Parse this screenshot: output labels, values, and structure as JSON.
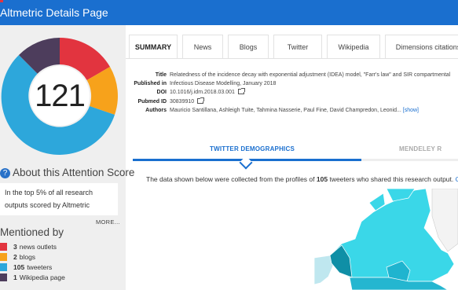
{
  "header": {
    "title": "Altmetric Details Page",
    "bg_color": "#1a6fcf"
  },
  "sidebar": {
    "score": "121",
    "about_title": "About this Attention Score",
    "rank_text": [
      "In the top 5% of all research",
      "outputs scored by Altmetric"
    ],
    "more_label": "MORE...",
    "mentioned_title": "Mentioned by",
    "mentions": [
      {
        "count": "3",
        "label": "news outlets",
        "color": "#e2343f"
      },
      {
        "count": "2",
        "label": "blogs",
        "color": "#f7a21b"
      },
      {
        "count": "105",
        "label": "tweeters",
        "color": "#2da7db"
      },
      {
        "count": "1",
        "label": "Wikipedia page",
        "color": "#4d3d5c"
      }
    ]
  },
  "tabs": [
    {
      "label": "SUMMARY",
      "active": true
    },
    {
      "label": "News"
    },
    {
      "label": "Blogs"
    },
    {
      "label": "Twitter"
    },
    {
      "label": "Wikipedia"
    },
    {
      "label": "Dimensions citations"
    }
  ],
  "details": {
    "title_label": "Title",
    "title_value": "Relatedness of the incidence decay with exponential adjustment (IDEA) model, \"Farr's law\" and SIR compartmental",
    "published_label": "Published in",
    "published_value": "Infectious Disease Modelling, January 2018",
    "doi_label": "DOI",
    "doi_value": "10.1016/j.idm.2018.03.001",
    "pubmed_label": "Pubmed ID",
    "pubmed_value": "30839910",
    "authors_label": "Authors",
    "authors_value": "Mauricio Santillana, Ashleigh Tuite, Tahmina Nasserie, Paul Fine, David Champredon, Leonid...",
    "show_label": "[show]"
  },
  "demographics": {
    "twitter_tab": "TWITTER DEMOGRAPHICS",
    "mendeley_tab": "MENDELEY R",
    "description_prefix": "The data shown below were collected from the profiles of",
    "tweeter_count": "105",
    "description_suffix": "tweeters who shared this research output.",
    "description_link": "C"
  }
}
